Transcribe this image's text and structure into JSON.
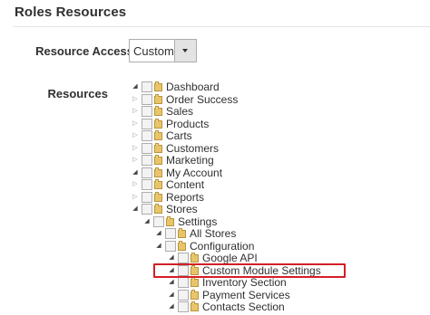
{
  "section": {
    "title": "Roles Resources"
  },
  "form": {
    "resource_access_label": "Resource Access",
    "resource_access_value": "Custom",
    "resources_label": "Resources"
  },
  "tree": [
    {
      "label": "Dashboard",
      "state": "open"
    },
    {
      "label": "Order Success",
      "state": "closed"
    },
    {
      "label": "Sales",
      "state": "closed"
    },
    {
      "label": "Products",
      "state": "closed"
    },
    {
      "label": "Carts",
      "state": "closed"
    },
    {
      "label": "Customers",
      "state": "closed"
    },
    {
      "label": "Marketing",
      "state": "closed"
    },
    {
      "label": "My Account",
      "state": "open"
    },
    {
      "label": "Content",
      "state": "closed"
    },
    {
      "label": "Reports",
      "state": "closed"
    },
    {
      "label": "Stores",
      "state": "open"
    },
    {
      "label": "Settings",
      "state": "open"
    },
    {
      "label": "All Stores",
      "state": "open"
    },
    {
      "label": "Configuration",
      "state": "open"
    },
    {
      "label": "Google API",
      "state": "open"
    },
    {
      "label": "Custom Module Settings",
      "state": "open",
      "highlighted": true
    },
    {
      "label": "Inventory Section",
      "state": "open"
    },
    {
      "label": "Payment Services",
      "state": "open"
    },
    {
      "label": "Contacts Section",
      "state": "open"
    }
  ],
  "colors": {
    "highlight": "#d31f26",
    "folder": "#e8c56a"
  }
}
